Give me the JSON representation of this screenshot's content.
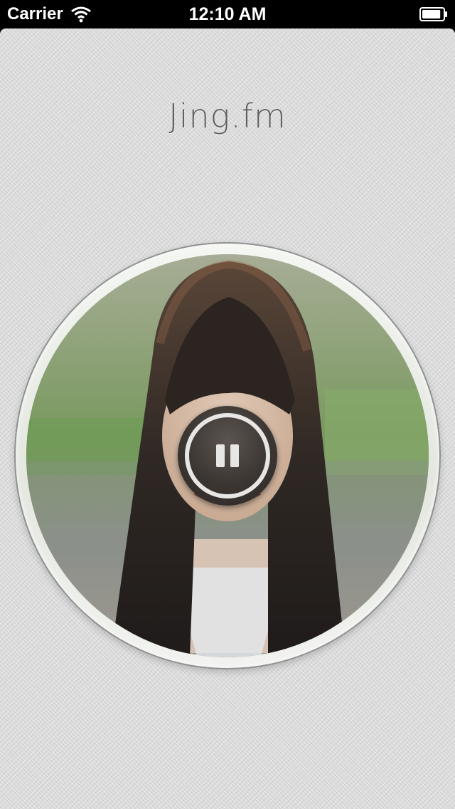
{
  "status_bar": {
    "carrier": "Carrier",
    "time": "12:10 AM",
    "icons": {
      "wifi": "wifi-icon",
      "battery": "battery-icon"
    },
    "battery_level": 0.9
  },
  "app": {
    "logo": "Jing.fm",
    "player": {
      "state": "playing",
      "control_icon": "pause-icon",
      "artwork": "album-art"
    }
  },
  "colors": {
    "background": "#dcdcdd",
    "logo_text": "#5f5f5f",
    "button_dark": "#3b3532",
    "button_ring": "#e8e6e4"
  }
}
